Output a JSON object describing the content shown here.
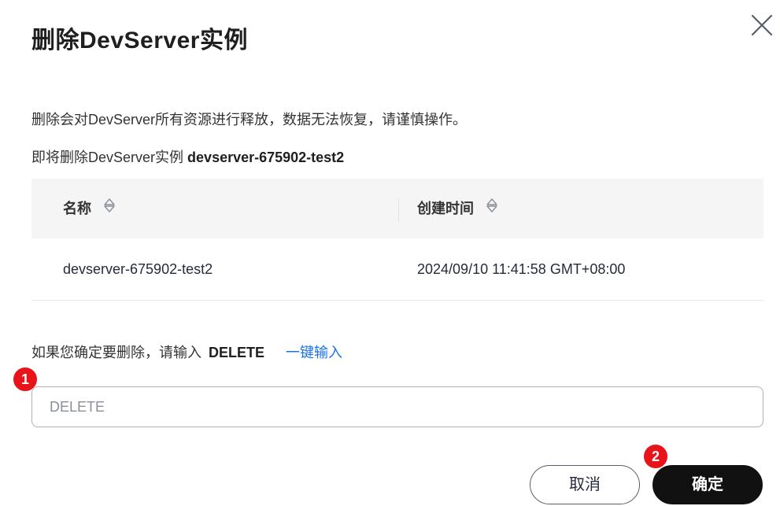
{
  "dialog": {
    "title": "删除DevServer实例",
    "close_icon": "close-icon",
    "warning_text": "删除会对DevServer所有资源进行释放，数据无法恢复，请谨慎操作。",
    "target_prefix": "即将删除DevServer实例",
    "target_name": "devserver-675902-test2"
  },
  "table": {
    "columns": [
      {
        "label": "名称",
        "sort_icon": "sort-icon"
      },
      {
        "label": "创建时间",
        "sort_icon": "sort-icon"
      }
    ],
    "rows": [
      {
        "name": "devserver-675902-test2",
        "created": "2024/09/10 11:41:58 GMT+08:00"
      }
    ]
  },
  "confirm": {
    "prompt": "如果您确定要删除，请输入",
    "keyword": "DELETE",
    "quick_fill_link": "一键输入",
    "input_placeholder": "DELETE",
    "input_value": ""
  },
  "annotations": {
    "badge_1": "1",
    "badge_2": "2",
    "badge_color": "#e8141a"
  },
  "buttons": {
    "cancel": "取消",
    "ok": "确定"
  },
  "colors": {
    "link": "#1a73e8",
    "primary_button": "#111111",
    "table_header_bg": "#f5f5f6"
  }
}
